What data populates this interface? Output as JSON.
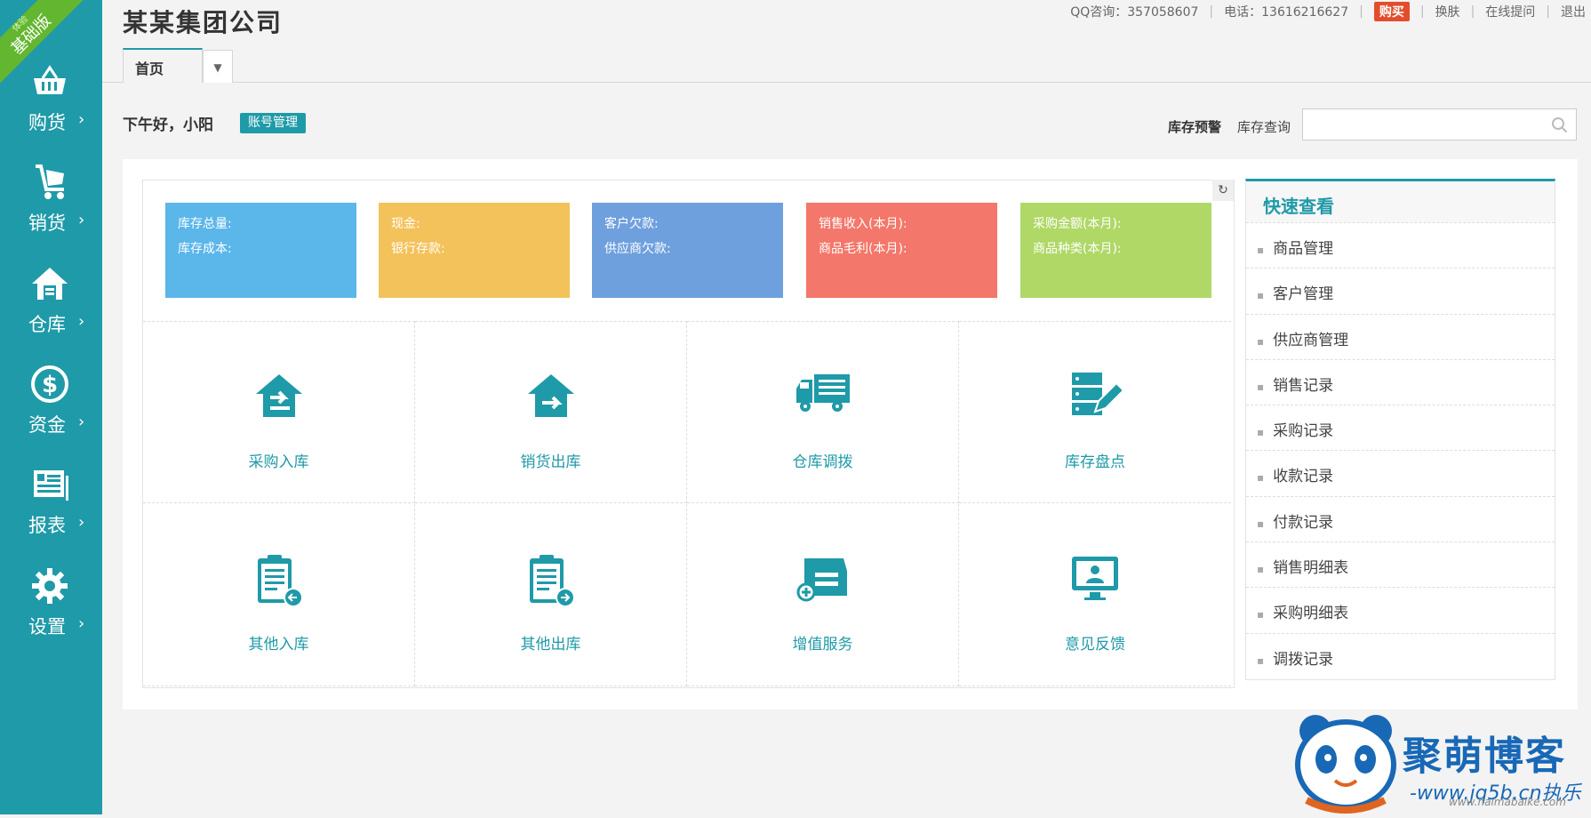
{
  "ribbon": {
    "small": "体验",
    "label": "基础版"
  },
  "sidebar": {
    "items": [
      {
        "label": "购货",
        "icon": "basket-icon"
      },
      {
        "label": "销货",
        "icon": "cart-icon"
      },
      {
        "label": "仓库",
        "icon": "house-icon"
      },
      {
        "label": "资金",
        "icon": "dollar-icon"
      },
      {
        "label": "报表",
        "icon": "report-icon"
      },
      {
        "label": "设置",
        "icon": "gear-icon"
      }
    ],
    "arrow": "›"
  },
  "header": {
    "company": "某某集团公司",
    "qq": "QQ咨询：357058607",
    "phone": "电话：13616216627",
    "buy": "购买",
    "skin": "换肤",
    "ask": "在线提问",
    "logout": "退出"
  },
  "tabs": [
    {
      "label": "首页"
    }
  ],
  "greeting": {
    "text": "下午好，小阳",
    "account_btn": "账号管理"
  },
  "stock": {
    "warn": "库存预警",
    "query": "库存查询",
    "search_placeholder": ""
  },
  "stats": [
    {
      "line1": "库存总量:",
      "line2": "库存成本:",
      "color": "#5bb6ea"
    },
    {
      "line1": "现金:",
      "line2": "银行存款:",
      "color": "#f4c25b"
    },
    {
      "line1": "客户欠款:",
      "line2": "供应商欠款:",
      "color": "#6fa0de"
    },
    {
      "line1": "销售收入(本月):",
      "line2": "商品毛利(本月):",
      "color": "#f3776a"
    },
    {
      "line1": "采购金额(本月):",
      "line2": "商品种类(本月):",
      "color": "#afd866"
    }
  ],
  "tiles": [
    {
      "label": "采购入库",
      "icon": "purchase-in-icon"
    },
    {
      "label": "销货出库",
      "icon": "sales-out-icon"
    },
    {
      "label": "仓库调拨",
      "icon": "truck-icon"
    },
    {
      "label": "库存盘点",
      "icon": "inventory-check-icon"
    },
    {
      "label": "其他入库",
      "icon": "clipboard-in-icon"
    },
    {
      "label": "其他出库",
      "icon": "clipboard-out-icon"
    },
    {
      "label": "增值服务",
      "icon": "service-box-icon"
    },
    {
      "label": "意见反馈",
      "icon": "feedback-monitor-icon"
    }
  ],
  "quick": {
    "title": "快速查看",
    "items": [
      "商品管理",
      "客户管理",
      "供应商管理",
      "销售记录",
      "采购记录",
      "收款记录",
      "付款记录",
      "销售明细表",
      "采购明细表",
      "调拨记录"
    ]
  },
  "watermark": {
    "title": "聚萌博客",
    "url": "-www.jq5b.cn执乐",
    "url2": "www.haimabaike.com"
  }
}
